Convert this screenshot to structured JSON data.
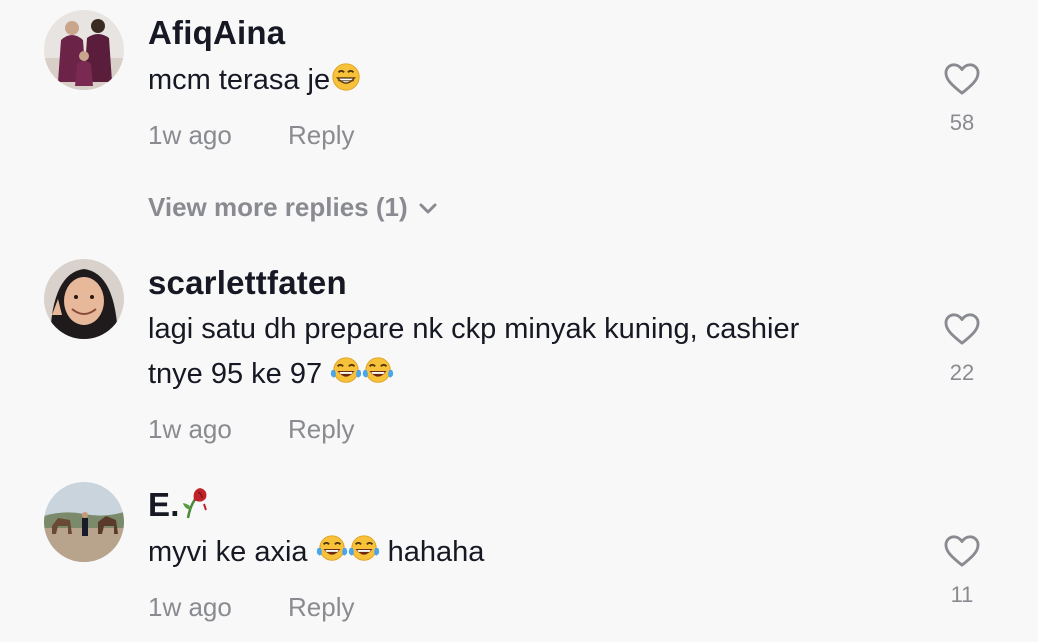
{
  "comments": [
    {
      "username": "AfiqAina",
      "text": "mcm terasa je",
      "emoji": [
        "grinning-face"
      ],
      "time": "1w ago",
      "reply_label": "Reply",
      "likes": "58",
      "view_more": "View more replies (1)"
    },
    {
      "username": "scarlettfaten",
      "text_line1": "lagi satu dh prepare nk ckp minyak kuning, cashier",
      "text_line2": "tnye 95 ke 97 ",
      "emoji": [
        "tears-of-joy",
        "tears-of-joy"
      ],
      "time": "1w ago",
      "reply_label": "Reply",
      "likes": "22"
    },
    {
      "username": "E.",
      "username_emoji": "wilted-rose",
      "text_pre": "myvi ke axia ",
      "emoji": [
        "tears-of-joy",
        "tears-of-joy"
      ],
      "text_post": " hahaha",
      "time": "1w ago",
      "reply_label": "Reply",
      "likes": "11"
    }
  ],
  "colors": {
    "background": "#f8f8f8",
    "primary_text": "#161823",
    "secondary_text": "#8a8b91"
  }
}
